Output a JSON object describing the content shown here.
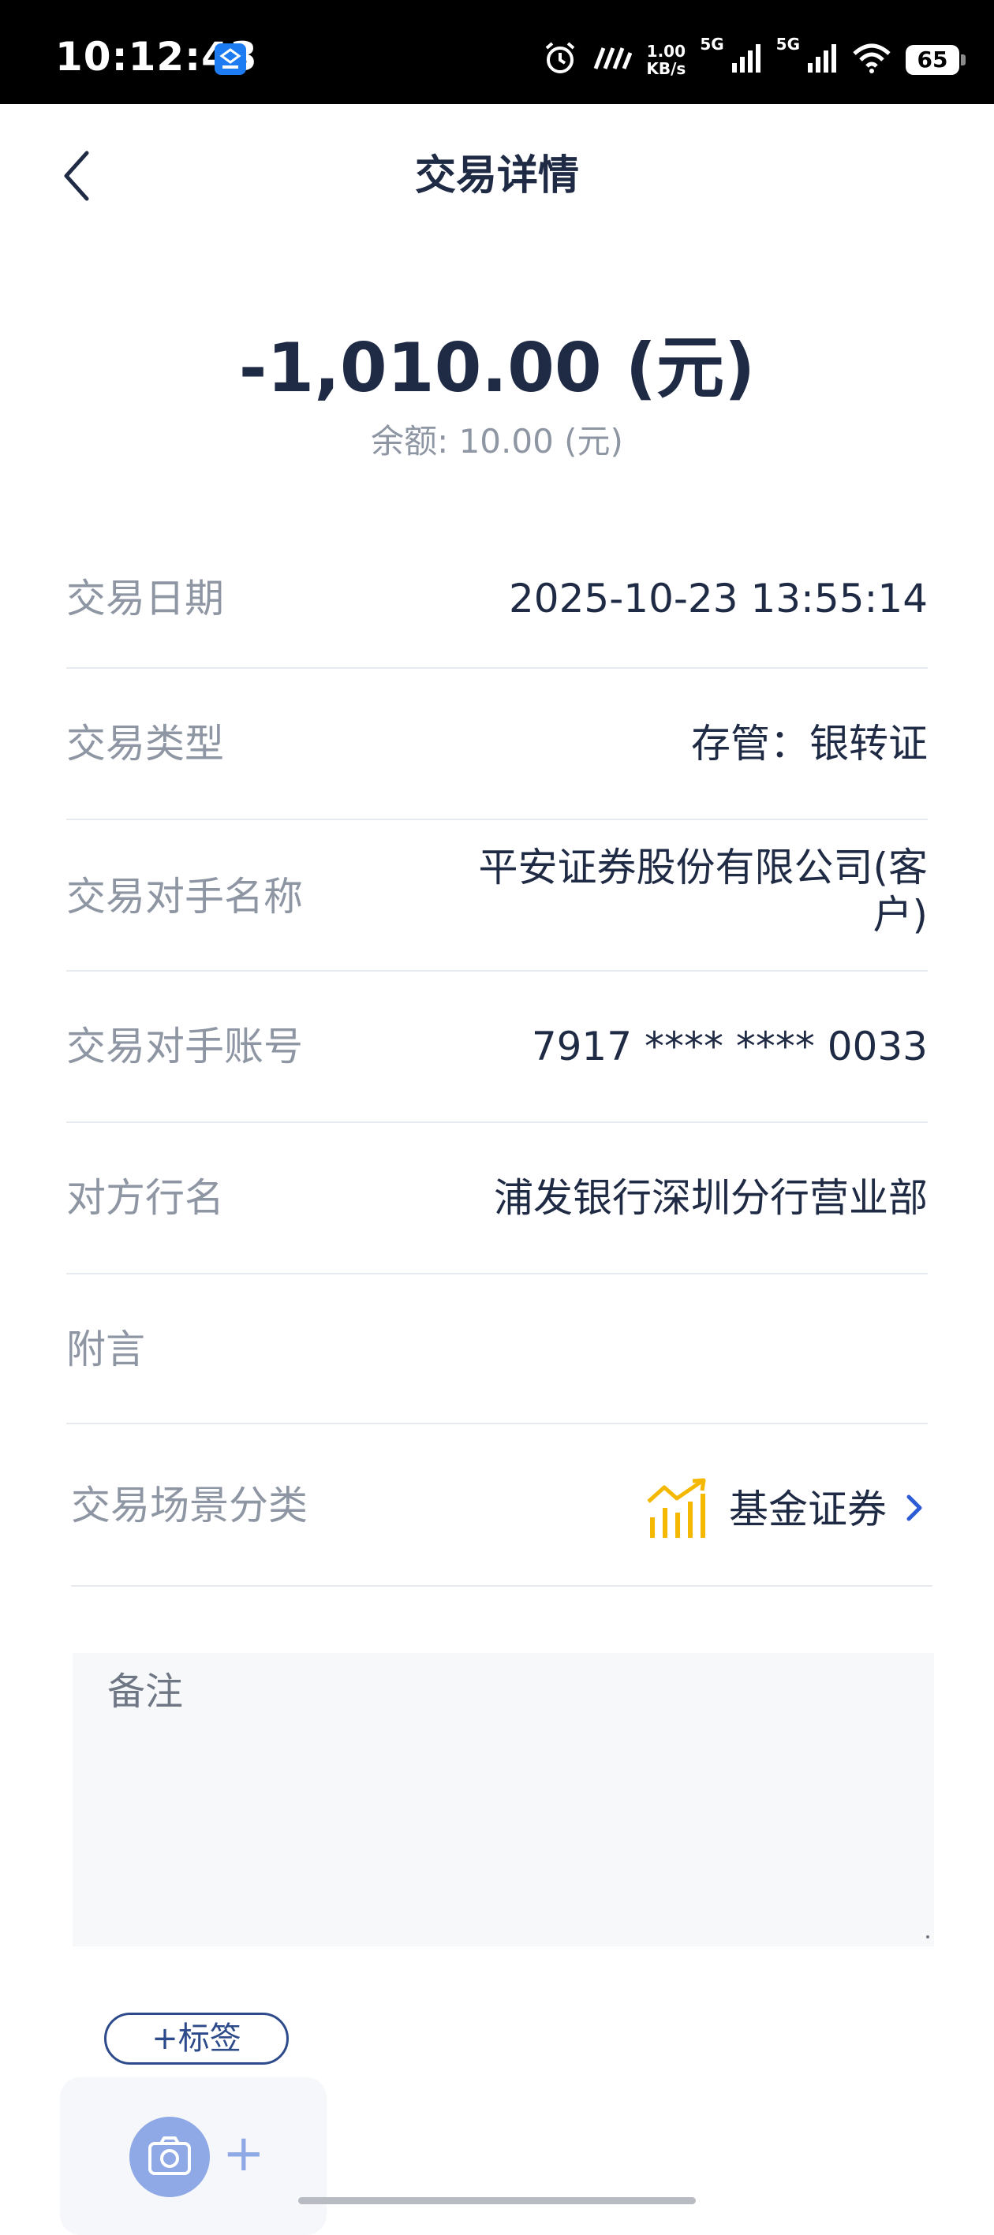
{
  "status_bar": {
    "time": "10:12:43",
    "net_speed_value": "1.00",
    "net_speed_unit": "KB/s",
    "signal_1_label": "5G",
    "signal_2_label": "5G",
    "battery": "65",
    "icons": [
      "app-notification-icon",
      "alarm-icon",
      "vibrate-icon",
      "signal-icon",
      "wifi-icon",
      "battery-icon"
    ]
  },
  "header": {
    "title": "交易详情",
    "back_icon": "chevron-left-icon"
  },
  "summary": {
    "amount": "-1,010.00 (元)",
    "balance": "余额: 10.00 (元)"
  },
  "details": [
    {
      "label": "交易日期",
      "value": "2025-10-23 13:55:14"
    },
    {
      "label": "交易类型",
      "value": "存管：银转证"
    },
    {
      "label": "交易对手名称",
      "value": "平安证券股份有限公司(客户)"
    },
    {
      "label": "交易对手账号",
      "value": "7917 **** **** 0033"
    },
    {
      "label": "对方行名",
      "value": "浦发银行深圳分行营业部"
    },
    {
      "label": "附言",
      "value": ""
    }
  ],
  "scene": {
    "label": "交易场景分类",
    "value": "基金证券",
    "icon": "rising-chart-icon",
    "icon_color": "#f5b800",
    "chevron_color": "#2d5bd6"
  },
  "remark": {
    "placeholder": "备注"
  },
  "tag": {
    "label": "+标签",
    "color": "#2d4a8a"
  },
  "photo": {
    "icon": "camera-icon",
    "plus": "+",
    "color": "#8ea9e6"
  }
}
